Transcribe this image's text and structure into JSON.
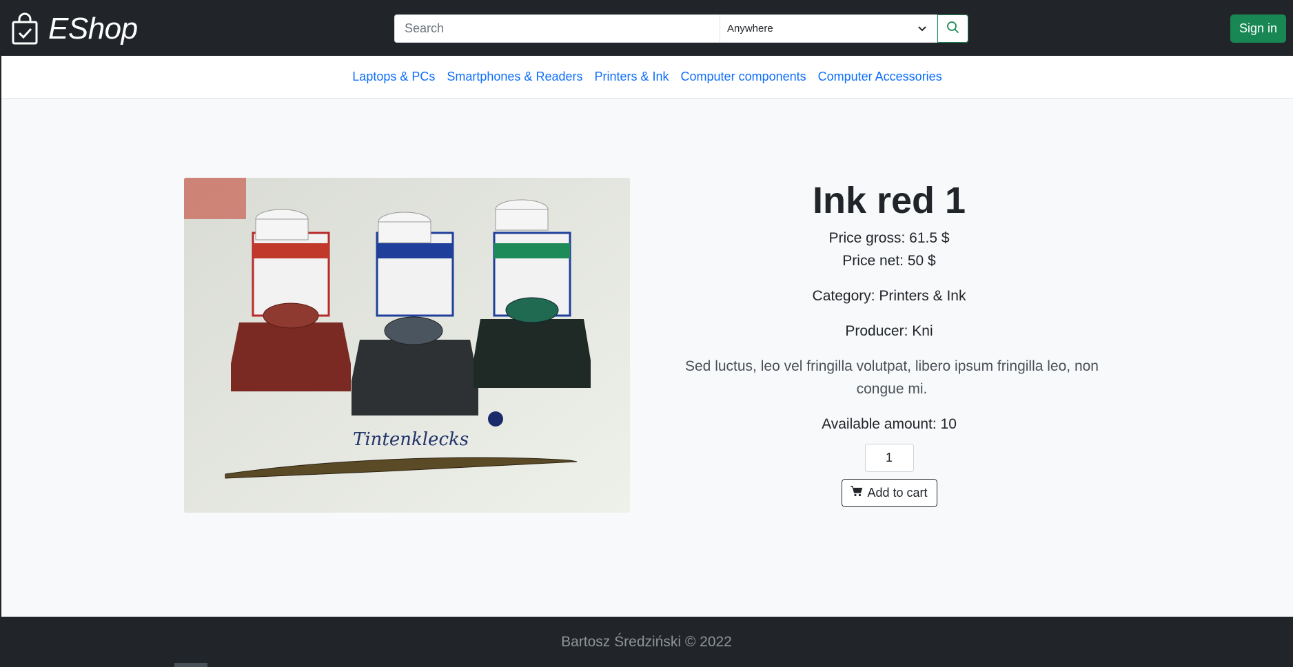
{
  "brand": {
    "name": "EShop",
    "icon": "shopping-bag-check-icon"
  },
  "search": {
    "placeholder": "Search",
    "value": "",
    "scope_selected": "Anywhere",
    "button_icon": "search-icon"
  },
  "auth": {
    "signin_label": "Sign in"
  },
  "categories": [
    {
      "label": "Laptops & PCs"
    },
    {
      "label": "Smartphones & Readers"
    },
    {
      "label": "Printers & Ink"
    },
    {
      "label": "Computer components"
    },
    {
      "label": "Computer Accessories"
    }
  ],
  "product": {
    "title": "Ink red 1",
    "price_gross": "Price gross: 61.5 $",
    "price_net": "Price net: 50 $",
    "category": "Category: Printers & Ink",
    "producer": "Producer: Kni",
    "description": "Sed luctus, leo vel fringilla volutpat, libero ipsum fringilla leo, non congue mi.",
    "available": "Available amount: 10",
    "quantity": "1",
    "add_to_cart_label": "Add to cart",
    "cart_icon": "cart-icon",
    "image_caption": "Tintenklecks"
  },
  "footer": {
    "text": "Bartosz Średziński © 2022"
  },
  "colors": {
    "navbar": "#212529",
    "accent_green": "#198754",
    "link_blue": "#0d6efd",
    "page_bg": "#f8f9fa"
  }
}
